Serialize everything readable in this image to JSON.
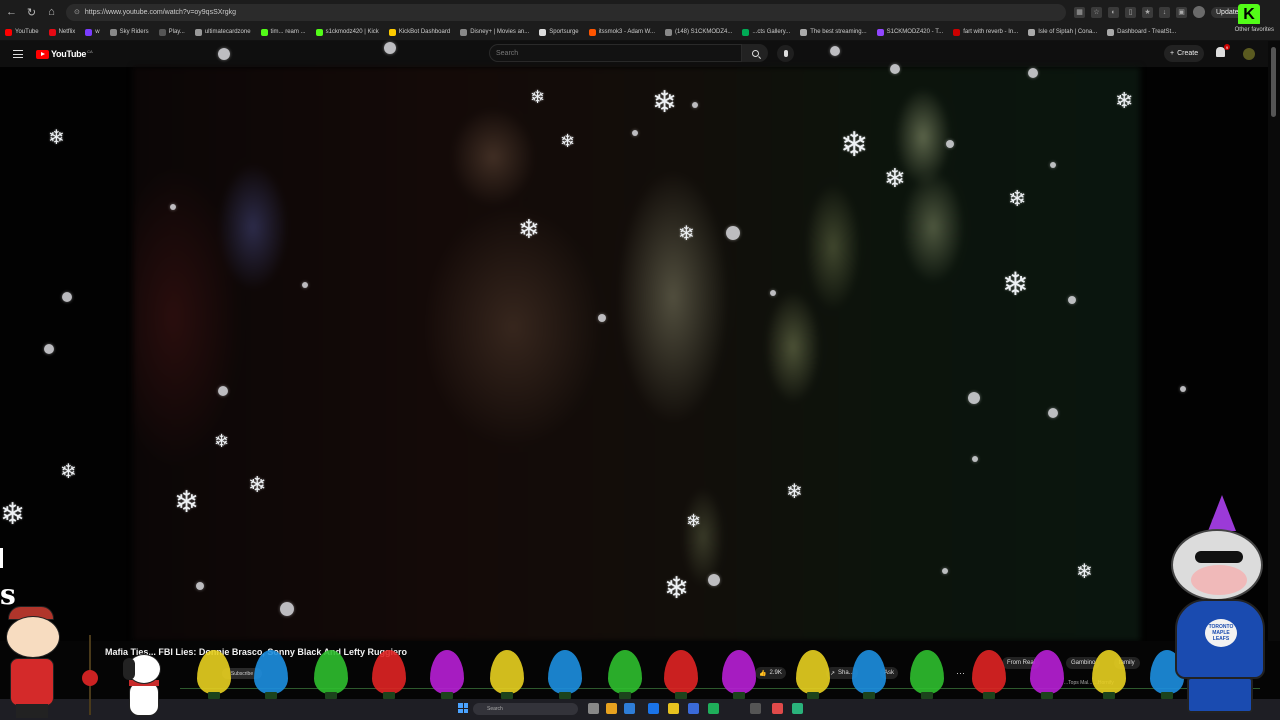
{
  "browser": {
    "url": "https://www.youtube.com/watch?v=oy9qsSXrgkg",
    "update_label": "Update",
    "bookmarks": [
      {
        "label": "YouTube",
        "color": "#ff0000"
      },
      {
        "label": "Netflix",
        "color": "#e50914"
      },
      {
        "label": "w",
        "color": "#7a3cff"
      },
      {
        "label": "Sky Riders",
        "color": "#888888"
      },
      {
        "label": "Play...",
        "color": "#555555"
      },
      {
        "label": "ultimatecardzone",
        "color": "#999999"
      },
      {
        "label": "tim... ream ...",
        "color": "#53fc18"
      },
      {
        "label": "s1ckmodz420 | Kick",
        "color": "#53fc18"
      },
      {
        "label": "KickBot Dashboard",
        "color": "#ffcc00"
      },
      {
        "label": "Disney+ | Movies an...",
        "color": "#888888"
      },
      {
        "label": "Sportsurge",
        "color": "#dddddd"
      },
      {
        "label": "itssmok3 - Adam W...",
        "color": "#ff5500"
      },
      {
        "label": "(148) S1CKMODZ4...",
        "color": "#888888"
      },
      {
        "label": "...cts Gallery...",
        "color": "#00aa55"
      },
      {
        "label": "The best streaming...",
        "color": "#aaaaaa"
      },
      {
        "label": "S1CKMODZ420 - T...",
        "color": "#9146ff"
      },
      {
        "label": "fart with reverb - In...",
        "color": "#cc0000"
      },
      {
        "label": "Isle of Siptah | Cona...",
        "color": "#aaaaaa"
      },
      {
        "label": "Dashboard - TreatSt...",
        "color": "#aaaaaa"
      }
    ],
    "other_favorites": "Other favorites"
  },
  "youtube": {
    "logo_text": "YouTube",
    "country_code": "CA",
    "search_placeholder": "Search",
    "create_label": "Create",
    "notification_count": "9"
  },
  "video": {
    "title": "Mafia Ties... FBI Lies: Donnie Brasco, Sonny Black And Lefty Ruggiero",
    "subscribe_label": "Subscribe",
    "likes": "2.9K",
    "share_label": "Sha...",
    "ask_label": "Ask",
    "more_label": "···",
    "chips": [
      "From Real",
      "Gambino",
      "family"
    ],
    "related_text": "...Tops Mal...    ...Hornify",
    "edge_text": "s"
  },
  "overlay": {
    "jersey_text": "TORONTO MAPLE LEAFS"
  },
  "taskbar": {
    "search_placeholder": "Search"
  },
  "colors": {
    "bulbs": [
      "#e8d020",
      "#1d8fe0",
      "#2fbf2f",
      "#e02424",
      "#b81fd6"
    ]
  }
}
